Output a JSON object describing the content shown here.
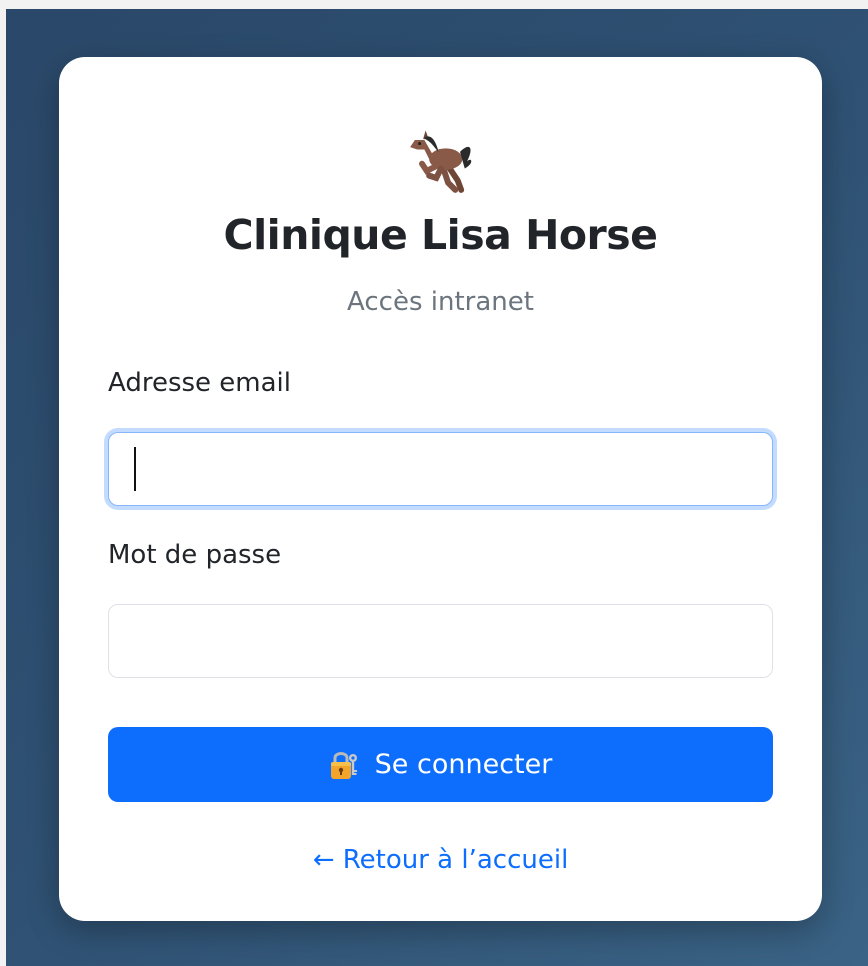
{
  "brand": {
    "logo_icon": "horse-icon",
    "title": "Clinique Lisa Horse",
    "subtitle": "Accès intranet"
  },
  "form": {
    "email": {
      "label": "Adresse email",
      "value": "",
      "placeholder": "",
      "focused": true
    },
    "password": {
      "label": "Mot de passe",
      "value": "",
      "placeholder": ""
    },
    "submit": {
      "icon": "lock-with-key-icon",
      "label": "Se connecter"
    }
  },
  "footer": {
    "back_link": "← Retour à l’accueil"
  },
  "colors": {
    "primary": "#0d6efd",
    "background": "#2f5173",
    "card": "#ffffff",
    "focus_ring": "#86b7fe"
  }
}
